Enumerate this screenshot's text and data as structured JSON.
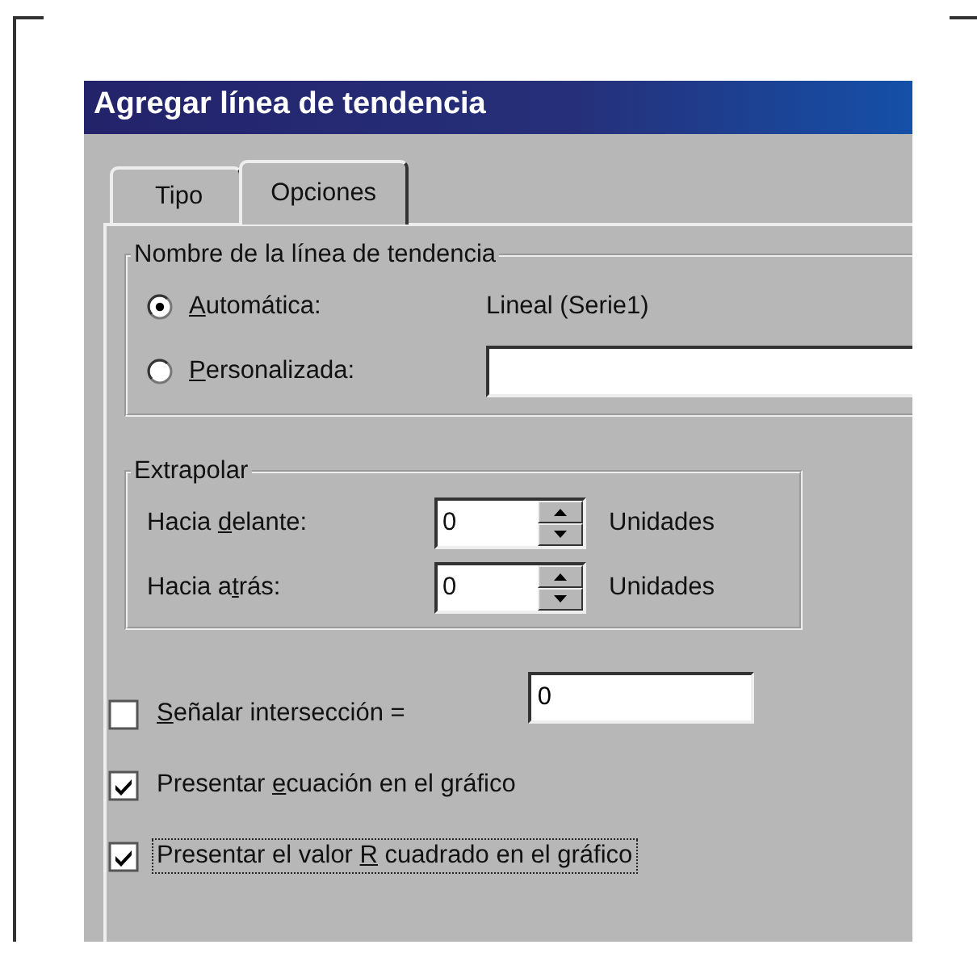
{
  "window": {
    "title": "Agregar línea de tendencia"
  },
  "tabs": [
    {
      "label": "Tipo",
      "selected": false
    },
    {
      "label": "Opciones",
      "selected": true
    }
  ],
  "name_group": {
    "title": "Nombre de la línea de tendencia",
    "options": [
      {
        "kind": "text",
        "label": {
          "key": "A",
          "after": "utomática:"
        },
        "selected": true,
        "value": "Lineal (Serie1)"
      },
      {
        "kind": "field",
        "label": {
          "key": "P",
          "after": "ersonalizada:"
        },
        "selected": false
      }
    ]
  },
  "extrapolate": {
    "title": "Extrapolar",
    "rows": [
      {
        "label": {
          "before": "Hacia ",
          "key": "d",
          "after": "elante:"
        },
        "value": "0",
        "unit": "Unidades"
      },
      {
        "label": {
          "before": "Hacia a",
          "key": "t",
          "after": "rás:"
        },
        "value": "0",
        "unit": "Unidades"
      }
    ]
  },
  "options": [
    {
      "kind": "field",
      "label": {
        "key": "S",
        "after": "eñalar intersección ="
      },
      "checked": false,
      "focused": false,
      "value": "0"
    },
    {
      "kind": "plain",
      "label": {
        "before": "Presentar ",
        "key": "e",
        "after": "cuación en el gráfico"
      },
      "checked": true,
      "focused": false
    },
    {
      "kind": "plain",
      "label": {
        "before": "Presentar el valor ",
        "key": "R",
        "after": " cuadrado en el gráfico"
      },
      "checked": true,
      "focused": true
    }
  ]
}
